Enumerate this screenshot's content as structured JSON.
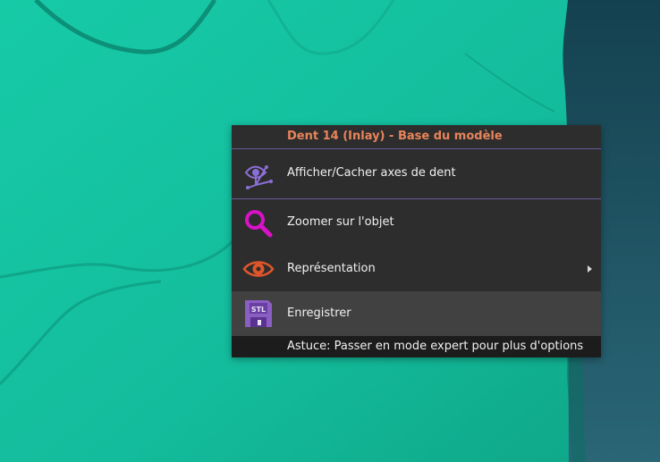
{
  "menu": {
    "title": "Dent 14 (Inlay) - Base du modèle",
    "items": [
      {
        "label": "Afficher/Cacher axes de dent",
        "icon": "tooth-axes-eye-icon"
      },
      {
        "label": "Zoomer sur l'objet",
        "icon": "magnifier-icon"
      },
      {
        "label": "Représentation",
        "icon": "eye-icon",
        "has_submenu": true
      },
      {
        "label": "Enregistrer",
        "icon": "stl-save-icon",
        "highlighted": true
      }
    ],
    "tip": "Astuce: Passer en mode expert pour plus d'options"
  },
  "colors": {
    "title": "#e8845a",
    "separator": "#6a5a9a",
    "menu_bg": "#2d2d2d",
    "highlight_bg": "#414141",
    "tip_bg": "#1c1c1c",
    "model": "#16c7a4",
    "background": "#1d5565",
    "axes_icon": "#8b6fd6",
    "zoom_icon": "#d912c8",
    "eye_icon": "#e0562a",
    "stl_icon": "#8a5ec2"
  }
}
